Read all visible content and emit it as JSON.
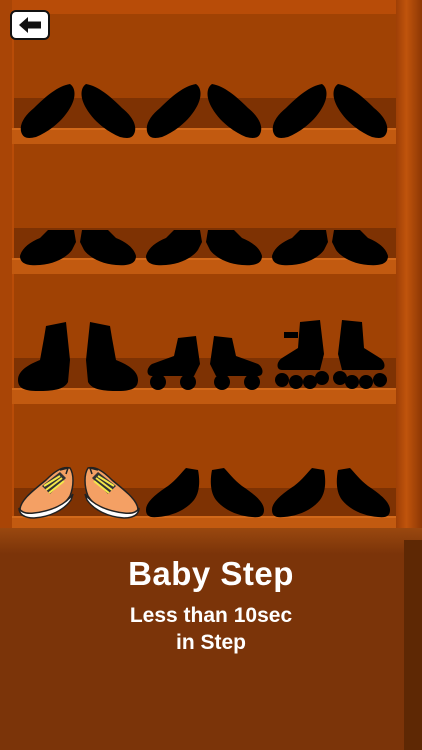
{
  "header": {
    "back_icon": "left-arrow-icon"
  },
  "colors": {
    "cabinet": "#b84c08",
    "back_panel": "#a04204",
    "counter": "#7b3409",
    "silhouette": "#000000",
    "sneaker_orange": "#f4a064",
    "sneaker_laces": "#f4e84a"
  },
  "shelves": [
    {
      "row": 1,
      "items": [
        "locked-loafer-shoe",
        "locked-loafer-shoe",
        "locked-loafer-shoe",
        "locked-loafer-shoe",
        "locked-loafer-shoe",
        "locked-loafer-shoe"
      ]
    },
    {
      "row": 2,
      "items": [
        "locked-clog-shoe",
        "locked-clog-shoe",
        "locked-clog-shoe",
        "locked-clog-shoe",
        "locked-clog-shoe",
        "locked-clog-shoe"
      ]
    },
    {
      "row": 3,
      "items": [
        "locked-boot",
        "locked-boot",
        "locked-roller-skate",
        "locked-roller-skate",
        "locked-inline-skate",
        "locked-inline-skate"
      ]
    },
    {
      "row": 4,
      "items": [
        "unlocked-sneaker",
        "unlocked-sneaker",
        "locked-dress-shoe",
        "locked-dress-shoe",
        "locked-dress-shoe",
        "locked-dress-shoe"
      ]
    }
  ],
  "achievement": {
    "title": "Baby Step",
    "line1": "Less than 10sec",
    "line2": "in Step"
  }
}
